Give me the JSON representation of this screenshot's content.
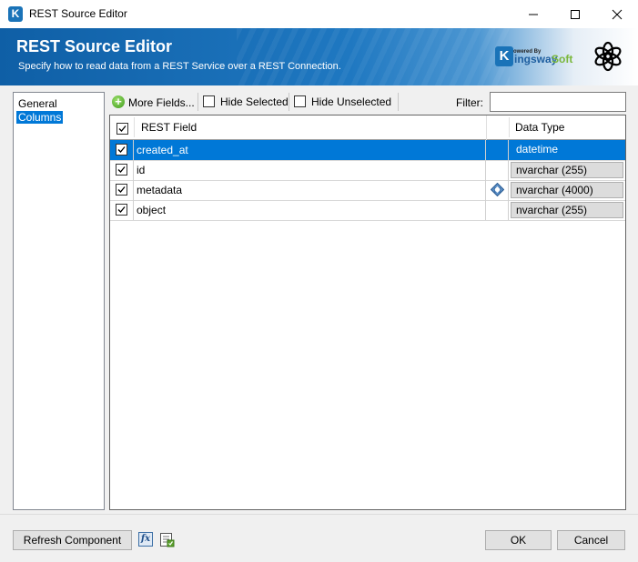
{
  "window": {
    "title": "REST Source Editor",
    "app_icon_letter": "K",
    "controls": [
      "minimize-icon",
      "maximize-icon",
      "close-icon"
    ]
  },
  "banner": {
    "title": "REST Source Editor",
    "subtitle": "Specify how to read data from a REST Service over a REST Connection.",
    "powered_by": "Powered By",
    "logo_k": "K",
    "logo_ingsway": "ingsway",
    "logo_soft": "Soft"
  },
  "nav": {
    "items": [
      {
        "label": "General",
        "selected": false
      },
      {
        "label": "Columns",
        "selected": true
      }
    ]
  },
  "toolbar": {
    "more_fields_label": "More Fields...",
    "hide_selected_label": "Hide Selected",
    "hide_unselected_label": "Hide Unselected",
    "filter_label": "Filter:",
    "filter_value": ""
  },
  "grid": {
    "columns": [
      "REST Field",
      "Data Type"
    ],
    "rows": [
      {
        "checked": true,
        "field": "created_at",
        "icon": "",
        "type": "datetime",
        "selected": true
      },
      {
        "checked": true,
        "field": "id",
        "icon": "",
        "type": "nvarchar (255)",
        "selected": false
      },
      {
        "checked": true,
        "field": "metadata",
        "icon": "json-document-icon",
        "type": "nvarchar (4000)",
        "selected": false
      },
      {
        "checked": true,
        "field": "object",
        "icon": "",
        "type": "nvarchar (255)",
        "selected": false
      }
    ]
  },
  "footer": {
    "refresh_label": "Refresh Component",
    "ok_label": "OK",
    "cancel_label": "Cancel"
  }
}
